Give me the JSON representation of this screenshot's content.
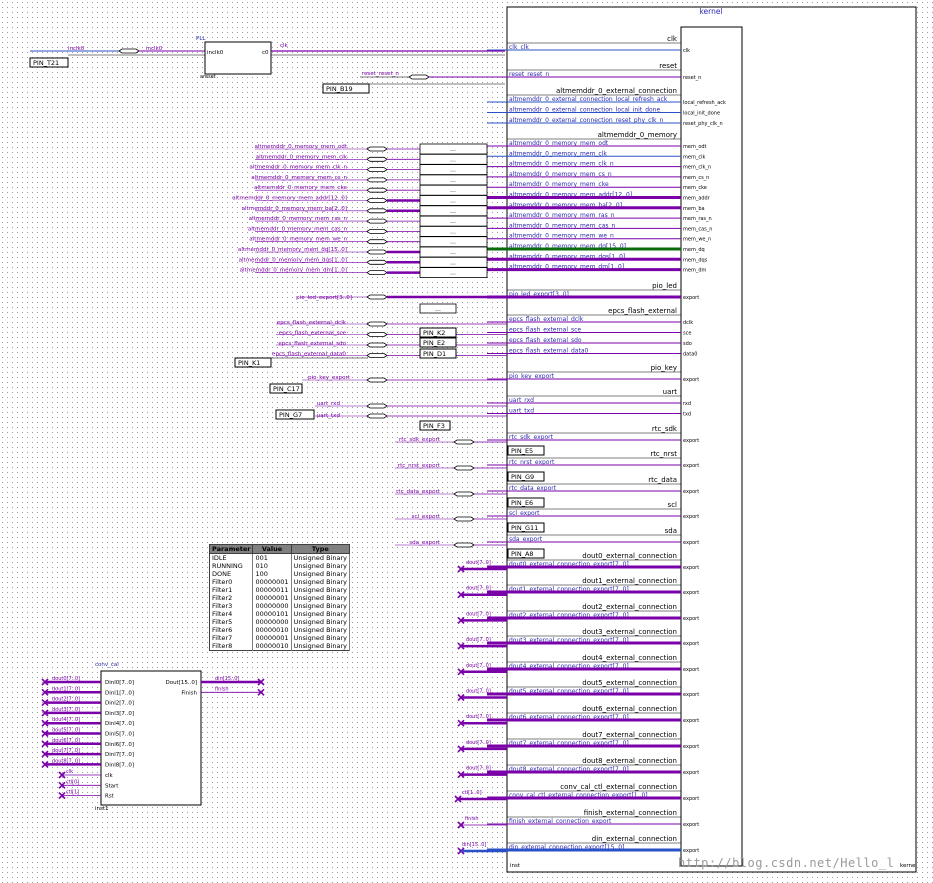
{
  "clocking": {
    "pll_label": "PLL",
    "pll_in_port": "inclk0",
    "pll_out_port": "c0",
    "pll_areset_port": "areset",
    "clk_wire": "inclk0",
    "clk_net": "clk",
    "clk_pin": "PIN_T21",
    "rst_pin": "PIN_B19",
    "rst_wire": "reset_reset_n"
  },
  "kernel": {
    "title": "kernel",
    "footer_left": "inst",
    "footer_right": "kernel",
    "groups": [
      {
        "header": "clk",
        "ports": [
          {
            "name": "clk_clk",
            "right": "clk"
          }
        ]
      },
      {
        "header": "reset",
        "ports": [
          {
            "name": "reset_reset_n",
            "right": "reset_n"
          }
        ]
      },
      {
        "header": "altmemddr_0_external_connection",
        "ports": [
          {
            "name": "altmemddr_0_external_connection_local_refresh_ack",
            "right": "local_refresh_ack"
          },
          {
            "name": "altmemddr_0_external_connection_local_init_done",
            "right": "local_init_done"
          },
          {
            "name": "altmemddr_0_external_connection_reset_phy_clk_n",
            "right": "reset_phy_clk_n"
          }
        ]
      },
      {
        "header": "altmemddr_0_memory",
        "ports": [
          {
            "name": "altmemddr_0_memory_mem_odt",
            "right": "mem_odt"
          },
          {
            "name": "altmemddr_0_memory_mem_clk",
            "right": "mem_clk"
          },
          {
            "name": "altmemddr_0_memory_mem_clk_n",
            "right": "mem_clk_n"
          },
          {
            "name": "altmemddr_0_memory_mem_cs_n",
            "right": "mem_cs_n"
          },
          {
            "name": "altmemddr_0_memory_mem_cke",
            "right": "mem_cke"
          },
          {
            "name": "altmemddr_0_memory_mem_addr[12..0]",
            "right": "mem_addr"
          },
          {
            "name": "altmemddr_0_memory_mem_ba[2..0]",
            "right": "mem_ba"
          },
          {
            "name": "altmemddr_0_memory_mem_ras_n",
            "right": "mem_ras_n"
          },
          {
            "name": "altmemddr_0_memory_mem_cas_n",
            "right": "mem_cas_n"
          },
          {
            "name": "altmemddr_0_memory_mem_we_n",
            "right": "mem_we_n"
          },
          {
            "name": "altmemddr_0_memory_mem_dq[15..0]",
            "right": "mem_dq"
          },
          {
            "name": "altmemddr_0_memory_mem_dqs[1..0]",
            "right": "mem_dqs"
          },
          {
            "name": "altmemddr_0_memory_mem_dm[1..0]",
            "right": "mem_dm"
          }
        ]
      },
      {
        "header": "pio_led",
        "ports": [
          {
            "name": "pio_led_export[3..0]",
            "right": "export"
          }
        ]
      },
      {
        "header": "epcs_flash_external",
        "ports": [
          {
            "name": "epcs_flash_external_dclk",
            "right": "dclk"
          },
          {
            "name": "epcs_flash_external_sce",
            "right": "sce"
          },
          {
            "name": "epcs_flash_external_sdo",
            "right": "sdo"
          },
          {
            "name": "epcs_flash_external_data0",
            "right": "data0"
          }
        ]
      },
      {
        "header": "pio_key",
        "ports": [
          {
            "name": "pio_key_export",
            "right": "export"
          }
        ]
      },
      {
        "header": "uart",
        "ports": [
          {
            "name": "uart_rxd",
            "right": "rxd"
          },
          {
            "name": "uart_txd",
            "right": "txd"
          }
        ]
      },
      {
        "header": "rtc_sdk",
        "ports": [
          {
            "name": "rtc_sdk_export",
            "right": "export"
          }
        ]
      },
      {
        "header": "rtc_nrst",
        "ports": [
          {
            "name": "rtc_nrst_export",
            "right": "export"
          }
        ]
      },
      {
        "header": "rtc_data",
        "ports": [
          {
            "name": "rtc_data_export",
            "right": "export"
          }
        ]
      },
      {
        "header": "scl",
        "ports": [
          {
            "name": "scl_export",
            "right": "export"
          }
        ]
      },
      {
        "header": "sda",
        "ports": [
          {
            "name": "sda_export",
            "right": "export"
          }
        ]
      },
      {
        "header": "dout0_external_connection",
        "ports": [
          {
            "name": "dout0_external_connection_export[7..0]",
            "right": "export"
          }
        ]
      },
      {
        "header": "dout1_external_connection",
        "ports": [
          {
            "name": "dout1_external_connection_export[7..0]",
            "right": "export"
          }
        ]
      },
      {
        "header": "dout2_external_connection",
        "ports": [
          {
            "name": "dout2_external_connection_export[7..0]",
            "right": "export"
          }
        ]
      },
      {
        "header": "dout3_external_connection",
        "ports": [
          {
            "name": "dout3_external_connection_export[7..0]",
            "right": "export"
          }
        ]
      },
      {
        "header": "dout4_external_connection",
        "ports": [
          {
            "name": "dout4_external_connection_export[7..0]",
            "right": "export"
          }
        ]
      },
      {
        "header": "dout5_external_connection",
        "ports": [
          {
            "name": "dout5_external_connection_export[7..0]",
            "right": "export"
          }
        ]
      },
      {
        "header": "dout6_external_connection",
        "ports": [
          {
            "name": "dout6_external_connection_export[7..0]",
            "right": "export"
          }
        ]
      },
      {
        "header": "dout7_external_connection",
        "ports": [
          {
            "name": "dout7_external_connection_export[7..0]",
            "right": "export"
          }
        ]
      },
      {
        "header": "dout8_external_connection",
        "ports": [
          {
            "name": "dout8_external_connection_export[7..0]",
            "right": "export"
          }
        ]
      },
      {
        "header": "conv_cal_ctl_external_connection",
        "ports": [
          {
            "name": "conv_cal_ctl_external_connection_export[1..0]",
            "right": "export"
          }
        ]
      },
      {
        "header": "finish_external_connection",
        "ports": [
          {
            "name": "finish_external_connection_export",
            "right": "export"
          }
        ]
      },
      {
        "header": "din_external_connection",
        "ports": [
          {
            "name": "din_external_connection_export[15..0]",
            "right": "export"
          }
        ]
      }
    ]
  },
  "left_nets": {
    "mem_labels": [
      "altmemddr_0_memory_mem_odt",
      "altmemddr_0_memory_mem_clk",
      "altmemddr_0_memory_mem_clk_n",
      "altmemddr_0_memory_mem_cs_n",
      "altmemddr_0_memory_mem_cke",
      "altmemddr_0_memory_mem_addr[12..0]",
      "altmemddr_0_memory_mem_ba[2..0]",
      "altmemddr_0_memory_mem_ras_n",
      "altmemddr_0_memory_mem_cas_n",
      "altmemddr_0_memory_mem_we_n",
      "altmemddr_0_memory_mem_dq[15..0]",
      "altmemddr_0_memory_mem_dqs[1..0]",
      "altmemddr_0_memory_mem_dm[1..0]"
    ],
    "pio_led": "pio_led_export[3..0]",
    "epcs_labels": [
      "epcs_flash_external_dclk",
      "epcs_flash_external_sce",
      "epcs_flash_external_sdo",
      "epcs_flash_external_data0"
    ],
    "pio_key": "pio_key_export",
    "uart_rxd": "uart_rxd",
    "uart_txd": "uart_txd",
    "rtc_sdk": "rtc_sdk_export",
    "rtc_nrst": "rtc_nrst_export",
    "rtc_data": "rtc_data_export",
    "scl": "scl_export",
    "sda": "sda_export",
    "dout_label": "dout[7..0]",
    "ctl_label": "ctl[1..0]",
    "finish_label": "finish",
    "din_label": "din[15..0]"
  },
  "pins": [
    {
      "label": "PIN_T21",
      "slot": "clk"
    },
    {
      "label": "PIN_B19",
      "slot": "rst"
    },
    {
      "label": "PIN_K2",
      "slot": "epcs1"
    },
    {
      "label": "PIN_E2",
      "slot": "epcs2"
    },
    {
      "label": "PIN_D1",
      "slot": "epcs3"
    },
    {
      "label": "PIN_K1",
      "slot": "epcs0"
    },
    {
      "label": "PIN_C17",
      "slot": "key"
    },
    {
      "label": "PIN_G7",
      "slot": "uart"
    },
    {
      "label": "PIN_F3",
      "slot": "uartb"
    },
    {
      "label": "PIN_E5",
      "slot": "rtc_sdk"
    },
    {
      "label": "PIN_G9",
      "slot": "rtc_nrst"
    },
    {
      "label": "PIN_E6",
      "slot": "rtc_data"
    },
    {
      "label": "PIN_G11",
      "slot": "scl"
    },
    {
      "label": "PIN_A8",
      "slot": "sda"
    }
  ],
  "param_table": {
    "headers": [
      "Parameter",
      "Value",
      "Type"
    ],
    "rows": [
      [
        "IDLE",
        "001",
        "Unsigned Binary"
      ],
      [
        "RUNNING",
        "010",
        "Unsigned Binary"
      ],
      [
        "DONE",
        "100",
        "Unsigned Binary"
      ],
      [
        "Filter0",
        "00000001",
        "Unsigned Binary"
      ],
      [
        "Filter1",
        "00000011",
        "Unsigned Binary"
      ],
      [
        "Filter2",
        "00000001",
        "Unsigned Binary"
      ],
      [
        "Filter3",
        "00000000",
        "Unsigned Binary"
      ],
      [
        "Filter4",
        "00000101",
        "Unsigned Binary"
      ],
      [
        "Filter5",
        "00000000",
        "Unsigned Binary"
      ],
      [
        "Filter6",
        "00000010",
        "Unsigned Binary"
      ],
      [
        "Filter7",
        "00000001",
        "Unsigned Binary"
      ],
      [
        "Filter8",
        "00000010",
        "Unsigned Binary"
      ]
    ]
  },
  "conv_cal": {
    "title": "conv_cal",
    "inst": "inst1",
    "inputs": [
      "Dinl0[7..0]",
      "Dinl1[7..0]",
      "Dinl2[7..0]",
      "Dinl3[7..0]",
      "Dinl4[7..0]",
      "Dinl5[7..0]",
      "Dinl6[7..0]",
      "Dinl7[7..0]",
      "Dinl8[7..0]"
    ],
    "input_nets": [
      "dout0[7..0]",
      "dout1[7..0]",
      "dout2[7..0]",
      "dout3[7..0]",
      "dout4[7..0]",
      "dout5[7..0]",
      "dout6[7..0]",
      "dout7[7..0]",
      "dout8[7..0]"
    ],
    "ctl_inputs": [
      "clk",
      "Start",
      "Rst"
    ],
    "ctl_nets": [
      "clk",
      "ctl[0]",
      "ctl[1]"
    ],
    "outputs": [
      "Dout[15..0]",
      "Finish"
    ],
    "output_nets": [
      "din[15..0]",
      "finish"
    ]
  },
  "watermark": "http://blog.csdn.net/Hello_l",
  "colors": {
    "wire": "#7a00a8",
    "bus": "#7a00a8",
    "blue_wire": "#2a50c8",
    "green_wire": "#0a6b0a",
    "block_border": "#000000"
  }
}
